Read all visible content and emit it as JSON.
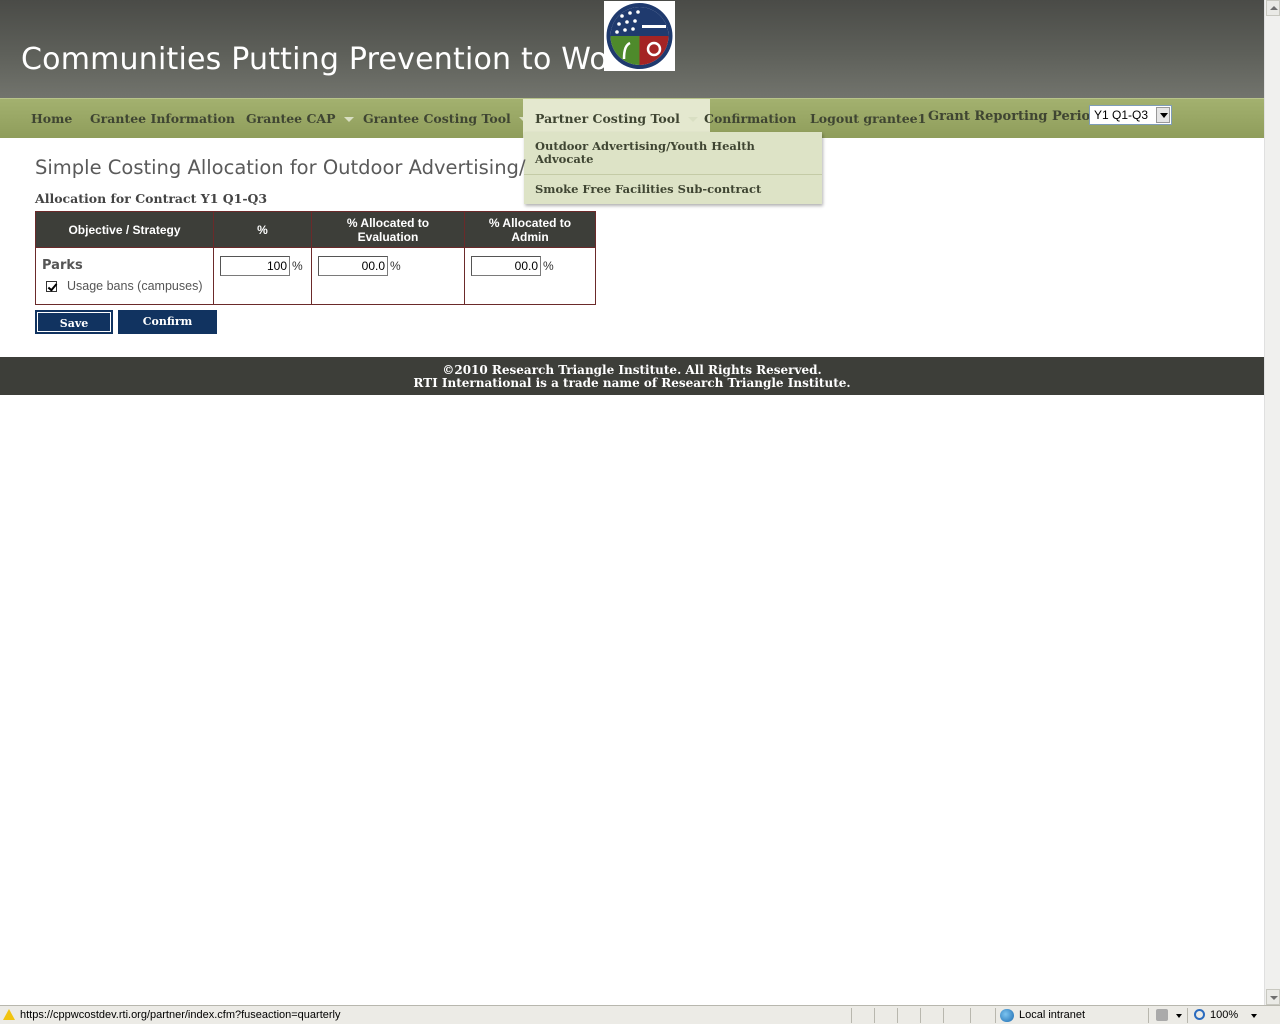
{
  "header": {
    "title": "Communities Putting Prevention to Work",
    "logo_alt": "recovery-gov-seal"
  },
  "nav": {
    "items": [
      {
        "label": "Home"
      },
      {
        "label": "Grantee Information"
      },
      {
        "label": "Grantee CAP"
      },
      {
        "label": "Grantee Costing Tool"
      },
      {
        "label": "Partner Costing Tool"
      },
      {
        "label": "Confirmation"
      },
      {
        "label": "Logout grantee1"
      }
    ],
    "period_label": "Grant Reporting Period:",
    "period_value": "Y1 Q1-Q3"
  },
  "dropdown": {
    "items": [
      {
        "label": "Outdoor Advertising/Youth Health Advocate"
      },
      {
        "label": "Smoke Free Facilities Sub-contract"
      }
    ]
  },
  "main": {
    "page_title": "Simple Costing Allocation for Outdoor Advertising/",
    "allocation_label": "Allocation for Contract Y1 Q1-Q3",
    "table": {
      "headers": [
        "Objective / Strategy",
        "%",
        "% Allocated to Evaluation",
        "% Allocated to Admin"
      ],
      "rows": [
        {
          "objective": "Parks",
          "strategy": "Usage bans (campuses)",
          "percent": "100",
          "evaluation": "00.0",
          "admin": "00.0",
          "unit": "%"
        }
      ]
    },
    "save_label": "Save",
    "confirm_label": "Confirm"
  },
  "footer": {
    "line1": "©2010 Research Triangle Institute. All Rights Reserved.",
    "line2": "RTI International is a trade name of Research Triangle Institute."
  },
  "statusbar": {
    "url": "https://cppwcostdev.rti.org/partner/index.cfm?fuseaction=quarterly",
    "zone": "Local intranet",
    "zoom": "100%"
  },
  "colors": {
    "header_bg": "#5e605a",
    "nav_bg": "#98a664",
    "button_bg": "#113360",
    "footer_bg": "#3d3e39",
    "table_border": "#6b2a2a"
  }
}
